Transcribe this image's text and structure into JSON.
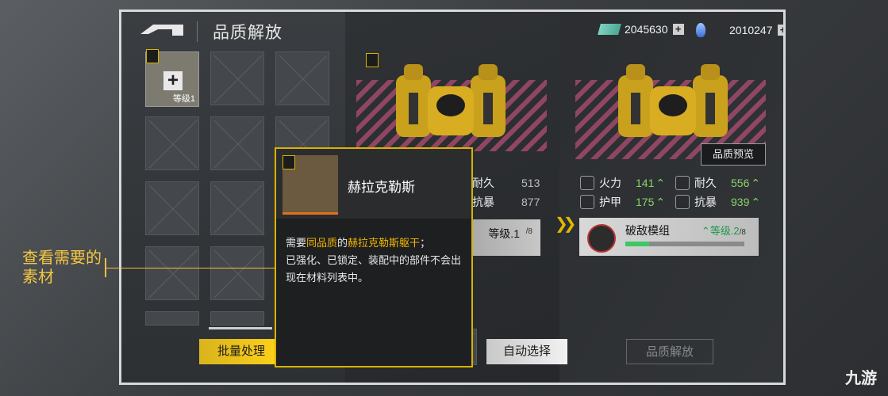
{
  "header": {
    "title": "品质解放",
    "currency1_value": "2045630",
    "currency2_value": "2010247",
    "plus_symbol": "+"
  },
  "inventory": {
    "add_plus": "+",
    "level_label": "等级1"
  },
  "tooltip": {
    "name": "赫拉克勒斯",
    "line1_pre": "需要",
    "line1_hl1": "同品质",
    "line1_mid": "的",
    "line1_hl2": "赫拉克勒斯躯干",
    "line1_post": "；",
    "line2": "已强化、已锁定、装配中的部件不会出现在材料列表中。"
  },
  "callout": {
    "text": "查看需要的素材"
  },
  "current": {
    "stats": [
      {
        "name": "耐久",
        "value": "513"
      },
      {
        "name": "抗暴",
        "value": "877"
      }
    ],
    "module_level": "等级.1",
    "module_max": "/8"
  },
  "preview": {
    "button": "品质预览",
    "stats": [
      {
        "name": "火力",
        "value": "141",
        "icon": "firepower-icon"
      },
      {
        "name": "耐久",
        "value": "556",
        "icon": "durability-icon"
      },
      {
        "name": "护甲",
        "value": "175",
        "icon": "armor-icon"
      },
      {
        "name": "抗暴",
        "value": "939",
        "icon": "crit-resist-icon"
      }
    ],
    "module_name": "破敌模组",
    "module_level": "等级.2",
    "module_max": "/8",
    "module_progress": 0.2
  },
  "buttons": {
    "batch": "批量处理",
    "auto": "自动选择",
    "release": "品质解放"
  },
  "watermark": "九游",
  "colors": {
    "accent_yellow": "#d9b300",
    "up_green": "#8ad36a",
    "highlight_orange": "#f0b400"
  }
}
